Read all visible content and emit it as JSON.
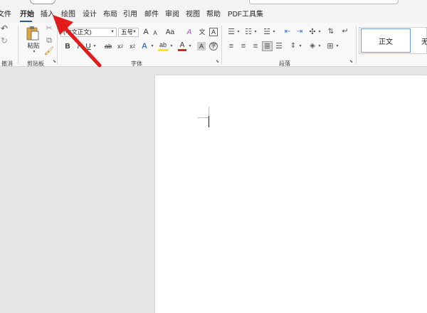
{
  "tabs": [
    {
      "label": "文件",
      "active": false
    },
    {
      "label": "开始",
      "active": true
    },
    {
      "label": "插入",
      "active": false
    },
    {
      "label": "绘图",
      "active": false
    },
    {
      "label": "设计",
      "active": false
    },
    {
      "label": "布局",
      "active": false
    },
    {
      "label": "引用",
      "active": false
    },
    {
      "label": "邮件",
      "active": false
    },
    {
      "label": "审阅",
      "active": false
    },
    {
      "label": "视图",
      "active": false
    },
    {
      "label": "帮助",
      "active": false
    },
    {
      "label": "PDF工具集",
      "active": false
    }
  ],
  "groups": {
    "undo": "撤消",
    "clipboard": "剪贴板",
    "font": "字体",
    "paragraph": "段落"
  },
  "clipboard": {
    "paste_label": "粘贴"
  },
  "font": {
    "name_value": "(中文正文)",
    "size_value": "五号",
    "grow": "A",
    "shrink": "A",
    "change_case": "Aa",
    "clear_format": "A",
    "phonetic": "文",
    "char_border": "A",
    "bold": "B",
    "italic": "I",
    "underline": "U",
    "strike": "ab",
    "subscript": "x",
    "superscript": "x",
    "sub_mark": "2",
    "sup_mark": "2",
    "text_effect": "A",
    "highlight": "ab",
    "font_color": "A",
    "char_shading": "A",
    "enclosed": "字"
  },
  "styles": {
    "item1": "正文",
    "item2": "无"
  },
  "colors": {
    "accent": "#2b5797",
    "arrow": "#e21b1b",
    "highlight": "#ffe600",
    "font_color": "#e02020"
  }
}
